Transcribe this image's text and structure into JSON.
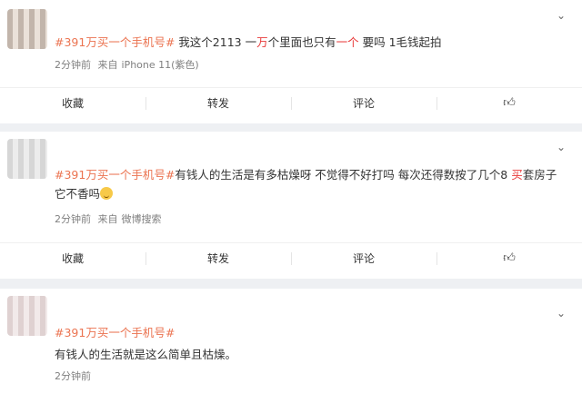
{
  "posts": [
    {
      "tag": "#391万买一个手机号#",
      "text_parts": [
        " 我这个2113 一",
        "万",
        "个里面也只有",
        "一个",
        " 要吗 1毛钱起拍"
      ],
      "time": "2分钟前",
      "source_prefix": "来自",
      "source": "iPhone 11(紫色)"
    },
    {
      "tag": "#391万买一个手机号#",
      "text_before": "有钱人的生活是有多枯燥呀 不觉得不好打吗 每次还得数按了几个8 ",
      "text_highlight": "买",
      "text_after": "套房子它不香吗",
      "emoji": "astonished-face",
      "time": "2分钟前",
      "source_prefix": "来自",
      "source": "微博搜索"
    },
    {
      "tag": "#391万买一个手机号#",
      "text": "有钱人的生活就是这么简单且枯燥。",
      "time": "2分钟前"
    }
  ],
  "actions": {
    "favorite": "收藏",
    "repost": "转发",
    "comment": "评论",
    "like_icon": "thumbs-up-icon"
  },
  "colors": {
    "tag": "#eb7350",
    "highlight": "#e83b3b",
    "background": "#eef0f3"
  }
}
